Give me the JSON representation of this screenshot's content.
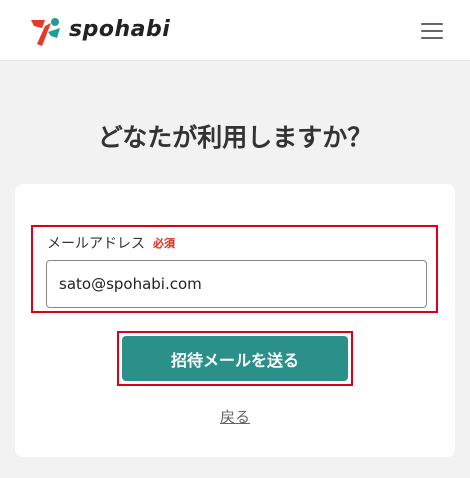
{
  "header": {
    "logo_text": "spohabi",
    "menu_icon": "hamburger-menu-icon"
  },
  "main": {
    "title": "どなたが利用しますか？"
  },
  "form": {
    "email_label": "メールアドレス",
    "required_badge": "必須",
    "email_value": "sato@spohabi.com",
    "submit_label": "招待メールを送る",
    "back_label": "戻る"
  },
  "colors": {
    "accent": "#2b9089",
    "required": "#e0281e",
    "highlight": "#d9001b",
    "logo_red": "#e83828",
    "logo_teal": "#1f9e96"
  }
}
